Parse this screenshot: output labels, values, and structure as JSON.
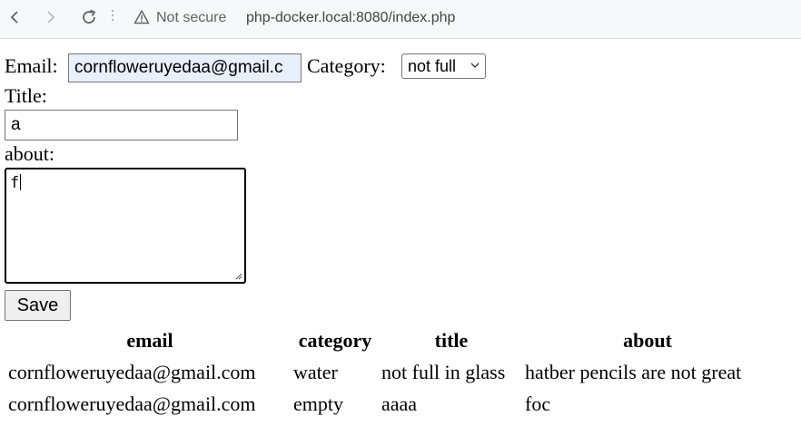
{
  "browser": {
    "security_label": "Not secure",
    "url": "php-docker.local:8080/index.php",
    "icons": [
      "back-arrow-icon",
      "forward-arrow-icon",
      "reload-icon",
      "warning-icon"
    ]
  },
  "form": {
    "email_label": "Email:",
    "email_value": "cornfloweruyedaa@gmail.c",
    "category_label": "Category:",
    "category_selected": "not full",
    "title_label": "Title:",
    "title_value": "a",
    "about_label": "about:",
    "about_value": "f",
    "save_label": "Save"
  },
  "table": {
    "headers": [
      "email",
      "category",
      "title",
      "about"
    ],
    "rows": [
      [
        "cornfloweruyedaa@gmail.com",
        "water",
        "not full in glass",
        "hatber pencils are not great"
      ],
      [
        "cornfloweruyedaa@gmail.com",
        "empty",
        "aaaa",
        "foc"
      ]
    ]
  },
  "colors": {
    "autofill_bg": "#e8f0fe",
    "toolbar_bg": "#f7f8fa"
  }
}
